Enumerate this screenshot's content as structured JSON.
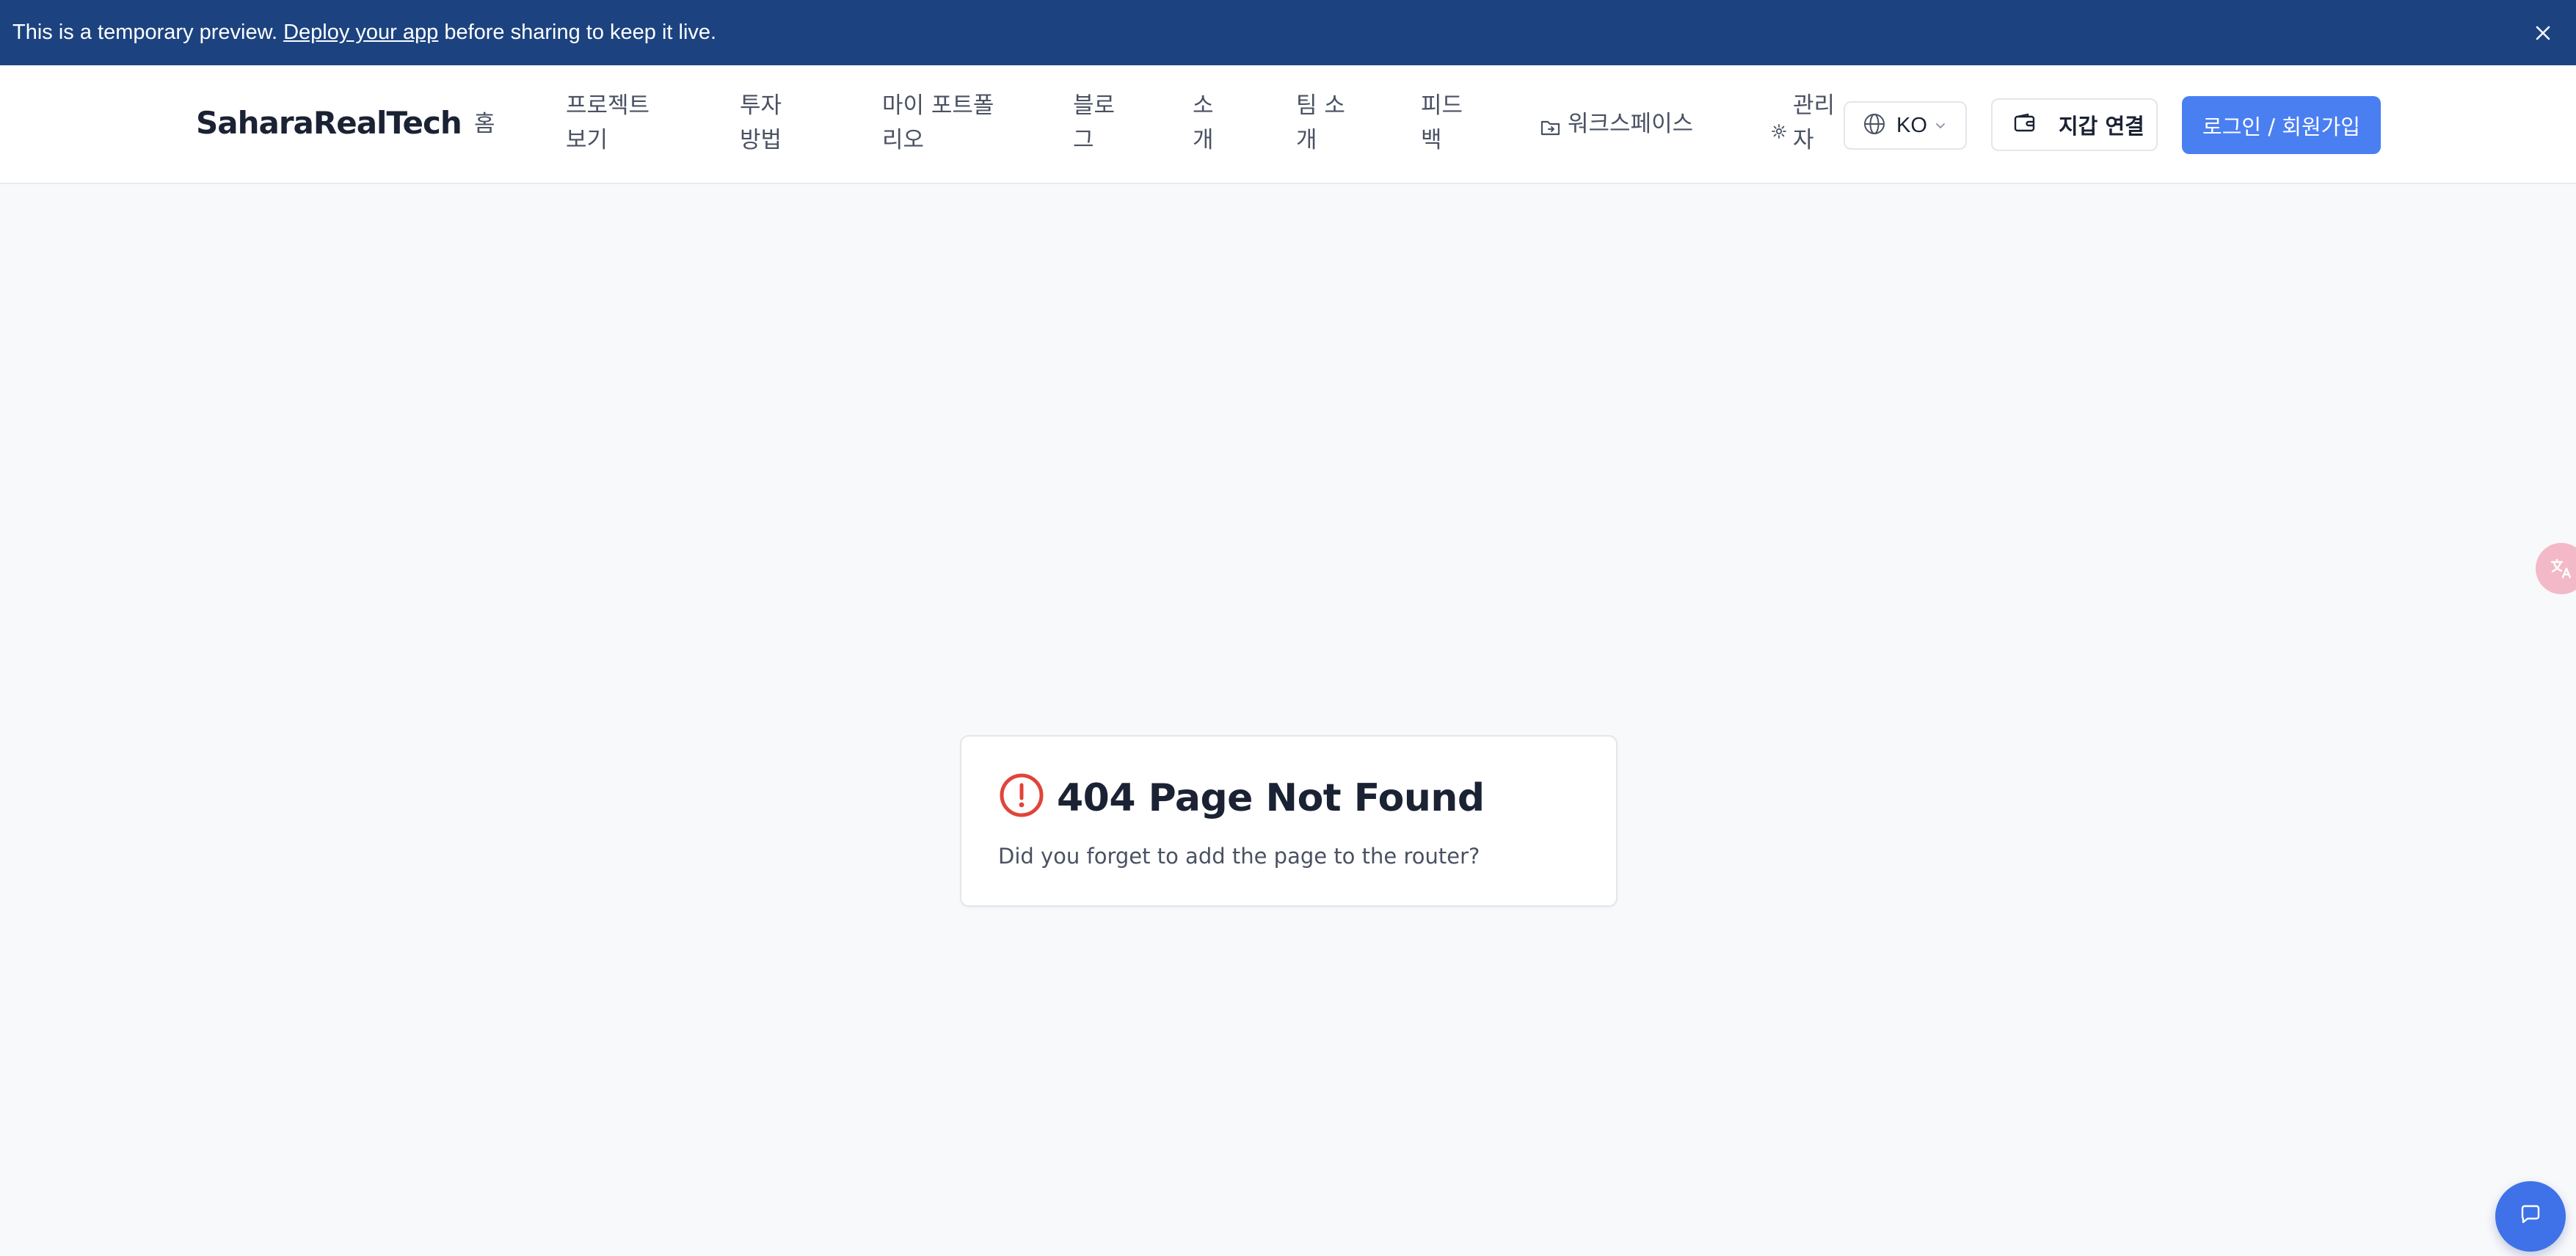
{
  "banner": {
    "text_before": "This is a temporary preview. ",
    "link_text": "Deploy your app",
    "text_after": " before sharing to keep it live.",
    "background_color": "#1c4380"
  },
  "header": {
    "logo": "SaharaRealTech",
    "nav": [
      {
        "label": "홈"
      },
      {
        "line1": "프로젝트",
        "line2": "보기"
      },
      {
        "line1": "투자",
        "line2": "방법"
      },
      {
        "line1": "마이 포트폴",
        "line2": "리오"
      },
      {
        "line1": "블로",
        "line2": "그"
      },
      {
        "line1": "소",
        "line2": "개"
      },
      {
        "line1": "팀 소",
        "line2": "개"
      },
      {
        "line1": "피드",
        "line2": "백"
      },
      {
        "label": "워크스페이스",
        "icon": "folder-icon"
      },
      {
        "line1": "관리",
        "line2": "자",
        "icon": "gear-icon"
      }
    ],
    "language": {
      "value": "KO",
      "icon": "globe-icon"
    },
    "wallet_button": {
      "label": "지갑 연결",
      "icon": "wallet-icon"
    },
    "login_button": {
      "label": "로그인 / 회원가입",
      "color": "#4a7ff2"
    }
  },
  "error_card": {
    "icon": "alert-circle-icon",
    "icon_color": "#e0443a",
    "title": "404 Page Not Found",
    "description": "Did you forget to add the page to the router?"
  },
  "floating": {
    "side_widget_icon": "translate-icon",
    "chat_icon": "chat-bubble-icon",
    "chat_color": "#3f72e8"
  }
}
